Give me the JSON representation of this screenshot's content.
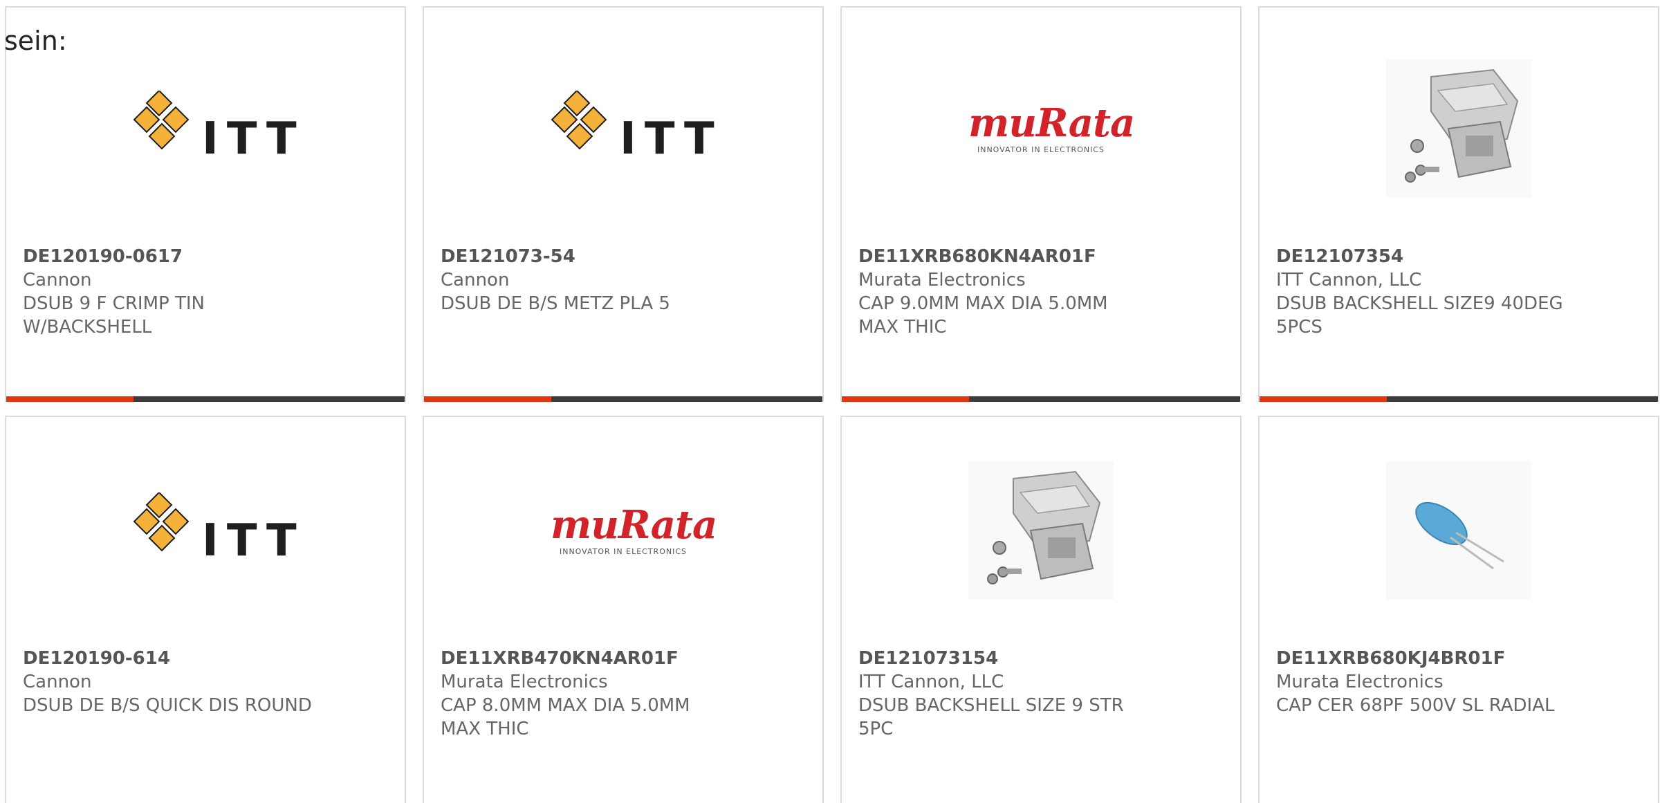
{
  "intro_text": "sein:",
  "accent_color": "#e8360c",
  "bar_color": "#3c3c3c",
  "products": [
    {
      "part_number": "DE120190-0617",
      "manufacturer": "Cannon",
      "description": "DSUB 9 F CRIMP TIN W/BACKSHELL",
      "image": "itt-logo",
      "logo_text": "ITT",
      "progress": 0.32
    },
    {
      "part_number": "DE121073-54",
      "manufacturer": "Cannon",
      "description": "DSUB DE B/S METZ PLA 5",
      "image": "itt-logo",
      "logo_text": "ITT",
      "progress": 0.32
    },
    {
      "part_number": "DE11XRB680KN4AR01F",
      "manufacturer": "Murata Electronics",
      "description": "CAP 9.0MM MAX DIA 5.0MM MAX THIC",
      "image": "murata-logo",
      "logo_text": "muRata",
      "logo_tagline": "INNOVATOR IN ELECTRONICS",
      "progress": 0.32
    },
    {
      "part_number": "DE12107354",
      "manufacturer": "ITT Cannon, LLC",
      "description": "DSUB BACKSHELL SIZE9 40DEG 5PCS",
      "image": "backshell-photo",
      "progress": 0.32
    },
    {
      "part_number": "DE120190-614",
      "manufacturer": "Cannon",
      "description": "DSUB DE B/S QUICK DIS ROUND",
      "image": "itt-logo",
      "logo_text": "ITT"
    },
    {
      "part_number": "DE11XRB470KN4AR01F",
      "manufacturer": "Murata Electronics",
      "description": "CAP 8.0MM MAX DIA 5.0MM MAX THIC",
      "image": "murata-logo",
      "logo_text": "muRata",
      "logo_tagline": "INNOVATOR IN ELECTRONICS"
    },
    {
      "part_number": "DE121073154",
      "manufacturer": "ITT Cannon, LLC",
      "description": "DSUB BACKSHELL SIZE 9 STR 5PC",
      "image": "backshell-photo"
    },
    {
      "part_number": "DE11XRB680KJ4BR01F",
      "manufacturer": "Murata Electronics",
      "description": "CAP CER 68PF 500V SL RADIAL",
      "image": "capacitor-photo"
    }
  ]
}
